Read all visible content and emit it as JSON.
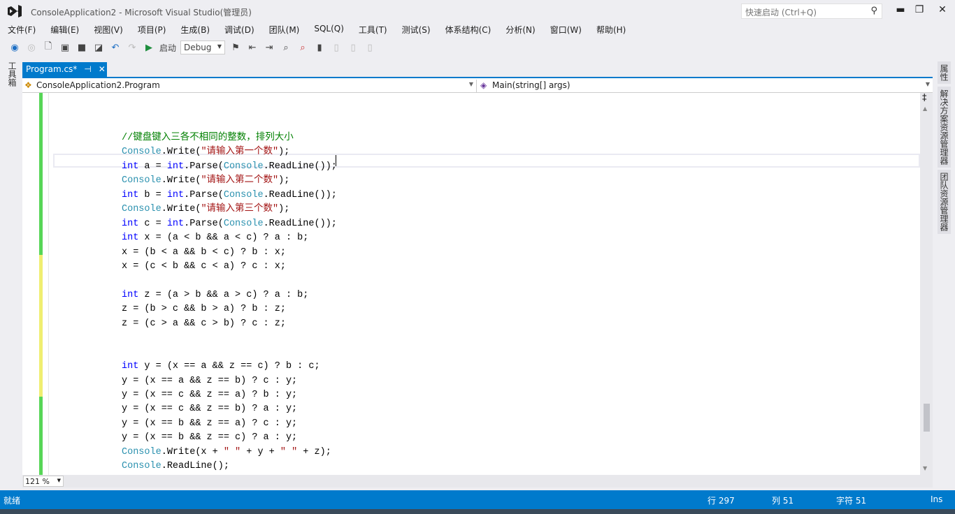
{
  "window": {
    "title": "ConsoleApplication2 - Microsoft Visual Studio(管理员)",
    "quick_launch": "快速启动 (Ctrl+Q)",
    "minimize": "▬",
    "restore": "❐",
    "close": "✕"
  },
  "menu": [
    "文件(F)",
    "编辑(E)",
    "视图(V)",
    "项目(P)",
    "生成(B)",
    "调试(D)",
    "团队(M)",
    "SQL(Q)",
    "工具(T)",
    "测试(S)",
    "体系结构(C)",
    "分析(N)",
    "窗口(W)",
    "帮助(H)"
  ],
  "toolbar": {
    "start": "启动",
    "config": "Debug"
  },
  "left_toolwindow": "工具箱",
  "tab": {
    "label": "Program.cs*",
    "pin": "⊣",
    "close": "✕"
  },
  "nav": {
    "class": "ConsoleApplication2.Program",
    "member": "Main(string[] args)"
  },
  "code": [
    [],
    [],
    [
      [
        "cm",
        "//键盘键入三各不相同的整数，排列大小"
      ]
    ],
    [
      [
        "ty",
        "Console"
      ],
      [
        "pl",
        "."
      ],
      [
        "pl",
        "Write("
      ],
      [
        "st",
        "\"请输入第一个数\""
      ],
      [
        "pl",
        ");"
      ]
    ],
    [
      [
        "kw",
        "int"
      ],
      [
        "pl",
        " a = "
      ],
      [
        "kw",
        "int"
      ],
      [
        "pl",
        ".Parse("
      ],
      [
        "ty",
        "Console"
      ],
      [
        "pl",
        ".ReadLine());"
      ]
    ],
    [
      [
        "ty",
        "Console"
      ],
      [
        "pl",
        ".Write("
      ],
      [
        "st",
        "\"请输入第二个数\""
      ],
      [
        "pl",
        ");"
      ]
    ],
    [
      [
        "kw",
        "int"
      ],
      [
        "pl",
        " b = "
      ],
      [
        "kw",
        "int"
      ],
      [
        "pl",
        ".Parse("
      ],
      [
        "ty",
        "Console"
      ],
      [
        "pl",
        ".ReadLine());"
      ]
    ],
    [
      [
        "ty",
        "Console"
      ],
      [
        "pl",
        ".Write("
      ],
      [
        "st",
        "\"请输入第三个数\""
      ],
      [
        "pl",
        ");"
      ]
    ],
    [
      [
        "kw",
        "int"
      ],
      [
        "pl",
        " c = "
      ],
      [
        "kw",
        "int"
      ],
      [
        "pl",
        ".Parse("
      ],
      [
        "ty",
        "Console"
      ],
      [
        "pl",
        ".ReadLine());"
      ]
    ],
    [
      [
        "kw",
        "int"
      ],
      [
        "pl",
        " x = (a < b && a < c) ? a : b;"
      ]
    ],
    [
      [
        "pl",
        "x = (b < a && b < c) ? b : x;"
      ]
    ],
    [
      [
        "pl",
        "x = (c < b && c < a) ? c : x;"
      ]
    ],
    [],
    [
      [
        "kw",
        "int"
      ],
      [
        "pl",
        " z = (a > b && a > c) ? a : b;"
      ]
    ],
    [
      [
        "pl",
        "z = (b > c && b > a) ? b : z;"
      ]
    ],
    [
      [
        "pl",
        "z = (c > a && c > b) ? c : z;"
      ]
    ],
    [],
    [],
    [
      [
        "kw",
        "int"
      ],
      [
        "pl",
        " y = (x == a && z == c) ? b : c;"
      ]
    ],
    [
      [
        "pl",
        "y = (x == a && z == b) ? c : y;"
      ]
    ],
    [
      [
        "pl",
        "y = (x == c && z == a) ? b : y;"
      ]
    ],
    [
      [
        "pl",
        "y = (x == c && z == b) ? a : y;"
      ]
    ],
    [
      [
        "pl",
        "y = (x == b && z == a) ? c : y;"
      ]
    ],
    [
      [
        "pl",
        "y = (x == b && z == c) ? a : y;"
      ]
    ],
    [
      [
        "ty",
        "Console"
      ],
      [
        "pl",
        ".Write(x + "
      ],
      [
        "st",
        "\" \""
      ],
      [
        "pl",
        " + y + "
      ],
      [
        "st",
        "\" \""
      ],
      [
        "pl",
        " + z);"
      ]
    ],
    [
      [
        "ty",
        "Console"
      ],
      [
        "pl",
        ".ReadLine();"
      ]
    ]
  ],
  "zoom": "121 %",
  "right_tabs": [
    "属性",
    "解决方案资源管理器",
    "团队资源管理器"
  ],
  "status": {
    "state": "就绪",
    "line": "行 297",
    "col": "列 51",
    "char": "字符 51",
    "mode": "Ins"
  },
  "colors": {
    "accent": "#007acc",
    "keyword": "#0000ff",
    "type": "#2b91af",
    "string": "#a31515",
    "comment": "#008000"
  }
}
